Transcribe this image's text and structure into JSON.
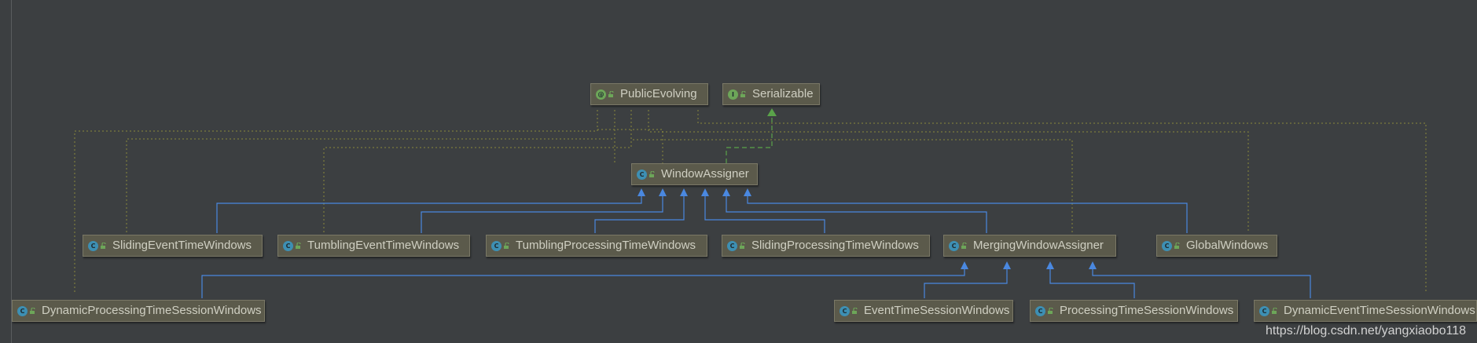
{
  "diagram": {
    "nodes": {
      "public_evolving": {
        "label": "PublicEvolving",
        "kind": "annotation",
        "kind_letter": "@"
      },
      "serializable": {
        "label": "Serializable",
        "kind": "interface",
        "kind_letter": "I"
      },
      "window_assigner": {
        "label": "WindowAssigner",
        "kind": "class",
        "kind_letter": "C"
      },
      "sliding_event_time_windows": {
        "label": "SlidingEventTimeWindows",
        "kind": "class",
        "kind_letter": "C"
      },
      "tumbling_event_time_windows": {
        "label": "TumblingEventTimeWindows",
        "kind": "class",
        "kind_letter": "C"
      },
      "tumbling_processing_time_windows": {
        "label": "TumblingProcessingTimeWindows",
        "kind": "class",
        "kind_letter": "C"
      },
      "sliding_processing_time_windows": {
        "label": "SlidingProcessingTimeWindows",
        "kind": "class",
        "kind_letter": "C"
      },
      "merging_window_assigner": {
        "label": "MergingWindowAssigner",
        "kind": "class",
        "kind_letter": "C"
      },
      "global_windows": {
        "label": "GlobalWindows",
        "kind": "class",
        "kind_letter": "C"
      },
      "dynamic_processing_time_session_windows": {
        "label": "DynamicProcessingTimeSessionWindows",
        "kind": "class",
        "kind_letter": "C"
      },
      "event_time_session_windows": {
        "label": "EventTimeSessionWindows",
        "kind": "class",
        "kind_letter": "C"
      },
      "processing_time_session_windows": {
        "label": "ProcessingTimeSessionWindows",
        "kind": "class",
        "kind_letter": "C"
      },
      "dynamic_event_time_session_windows": {
        "label": "DynamicEventTimeSessionWindows",
        "kind": "class",
        "kind_letter": "C"
      }
    },
    "edges": [
      {
        "from": "window_assigner",
        "to": "serializable",
        "type": "implements"
      },
      {
        "from": "sliding_event_time_windows",
        "to": "window_assigner",
        "type": "extends"
      },
      {
        "from": "tumbling_event_time_windows",
        "to": "window_assigner",
        "type": "extends"
      },
      {
        "from": "tumbling_processing_time_windows",
        "to": "window_assigner",
        "type": "extends"
      },
      {
        "from": "sliding_processing_time_windows",
        "to": "window_assigner",
        "type": "extends"
      },
      {
        "from": "merging_window_assigner",
        "to": "window_assigner",
        "type": "extends"
      },
      {
        "from": "global_windows",
        "to": "window_assigner",
        "type": "extends"
      },
      {
        "from": "dynamic_processing_time_session_windows",
        "to": "merging_window_assigner",
        "type": "extends"
      },
      {
        "from": "event_time_session_windows",
        "to": "merging_window_assigner",
        "type": "extends"
      },
      {
        "from": "processing_time_session_windows",
        "to": "merging_window_assigner",
        "type": "extends"
      },
      {
        "from": "dynamic_event_time_session_windows",
        "to": "merging_window_assigner",
        "type": "extends"
      },
      {
        "from": "window_assigner",
        "to": "public_evolving",
        "type": "annotated"
      },
      {
        "from": "sliding_event_time_windows",
        "to": "public_evolving",
        "type": "annotated"
      },
      {
        "from": "tumbling_event_time_windows",
        "to": "public_evolving",
        "type": "annotated"
      },
      {
        "from": "merging_window_assigner",
        "to": "public_evolving",
        "type": "annotated"
      },
      {
        "from": "global_windows",
        "to": "public_evolving",
        "type": "annotated"
      },
      {
        "from": "dynamic_processing_time_session_windows",
        "to": "public_evolving",
        "type": "annotated"
      },
      {
        "from": "dynamic_event_time_session_windows",
        "to": "public_evolving",
        "type": "annotated"
      }
    ],
    "colors": {
      "background": "#3c3f41",
      "node_fill": "#5b5a4b",
      "node_border": "#7a7866",
      "node_text": "#cfcfc2",
      "extends_edge": "#4a88e0",
      "implements_edge": "#5aa34a",
      "annotation_edge": "#8a8a3a"
    }
  },
  "watermark": "https://blog.csdn.net/yangxiaobo118"
}
